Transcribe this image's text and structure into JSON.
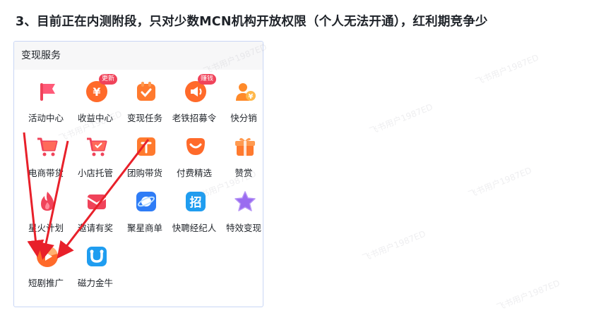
{
  "heading": "3、目前正在内测附段，只对少数MCN机构开放权限（个人无法开通），红利期竞争少",
  "panel": {
    "title": "变现服务",
    "items": [
      {
        "label": "活动中心",
        "icon": "flag-icon",
        "badge": ""
      },
      {
        "label": "收益中心",
        "icon": "yuan-coin-icon",
        "badge": "更新"
      },
      {
        "label": "变现任务",
        "icon": "task-check-icon",
        "badge": ""
      },
      {
        "label": "老铁招募令",
        "icon": "megaphone-icon",
        "badge": "赚钱"
      },
      {
        "label": "快分销",
        "icon": "distributor-icon",
        "badge": ""
      },
      {
        "label": "电商带货",
        "icon": "shopping-cart-icon",
        "badge": ""
      },
      {
        "label": "小店托管",
        "icon": "store-cart-icon",
        "badge": ""
      },
      {
        "label": "团购带货",
        "icon": "group-buy-icon",
        "badge": ""
      },
      {
        "label": "付费精选",
        "icon": "smile-icon",
        "badge": ""
      },
      {
        "label": "赞赏",
        "icon": "gift-icon",
        "badge": ""
      },
      {
        "label": "星火计划",
        "icon": "flame-icon",
        "badge": ""
      },
      {
        "label": "邀请有奖",
        "icon": "envelope-icon",
        "badge": ""
      },
      {
        "label": "聚星商单",
        "icon": "planet-icon",
        "badge": ""
      },
      {
        "label": "快聘经纪人",
        "icon": "recruit-icon",
        "badge": ""
      },
      {
        "label": "特效变现",
        "icon": "star-icon",
        "badge": ""
      },
      {
        "label": "短剧推广",
        "icon": "drama-play-icon",
        "badge": ""
      },
      {
        "label": "磁力金牛",
        "icon": "magnet-icon",
        "badge": ""
      }
    ]
  },
  "watermark": "飞书用户1987ED",
  "colors": {
    "accent_orange": "#ff6a2a",
    "accent_red": "#f0435a",
    "accent_blue": "#2e7cf6",
    "accent_purple": "#9a6cf0",
    "arrow_red": "#e8202a"
  }
}
